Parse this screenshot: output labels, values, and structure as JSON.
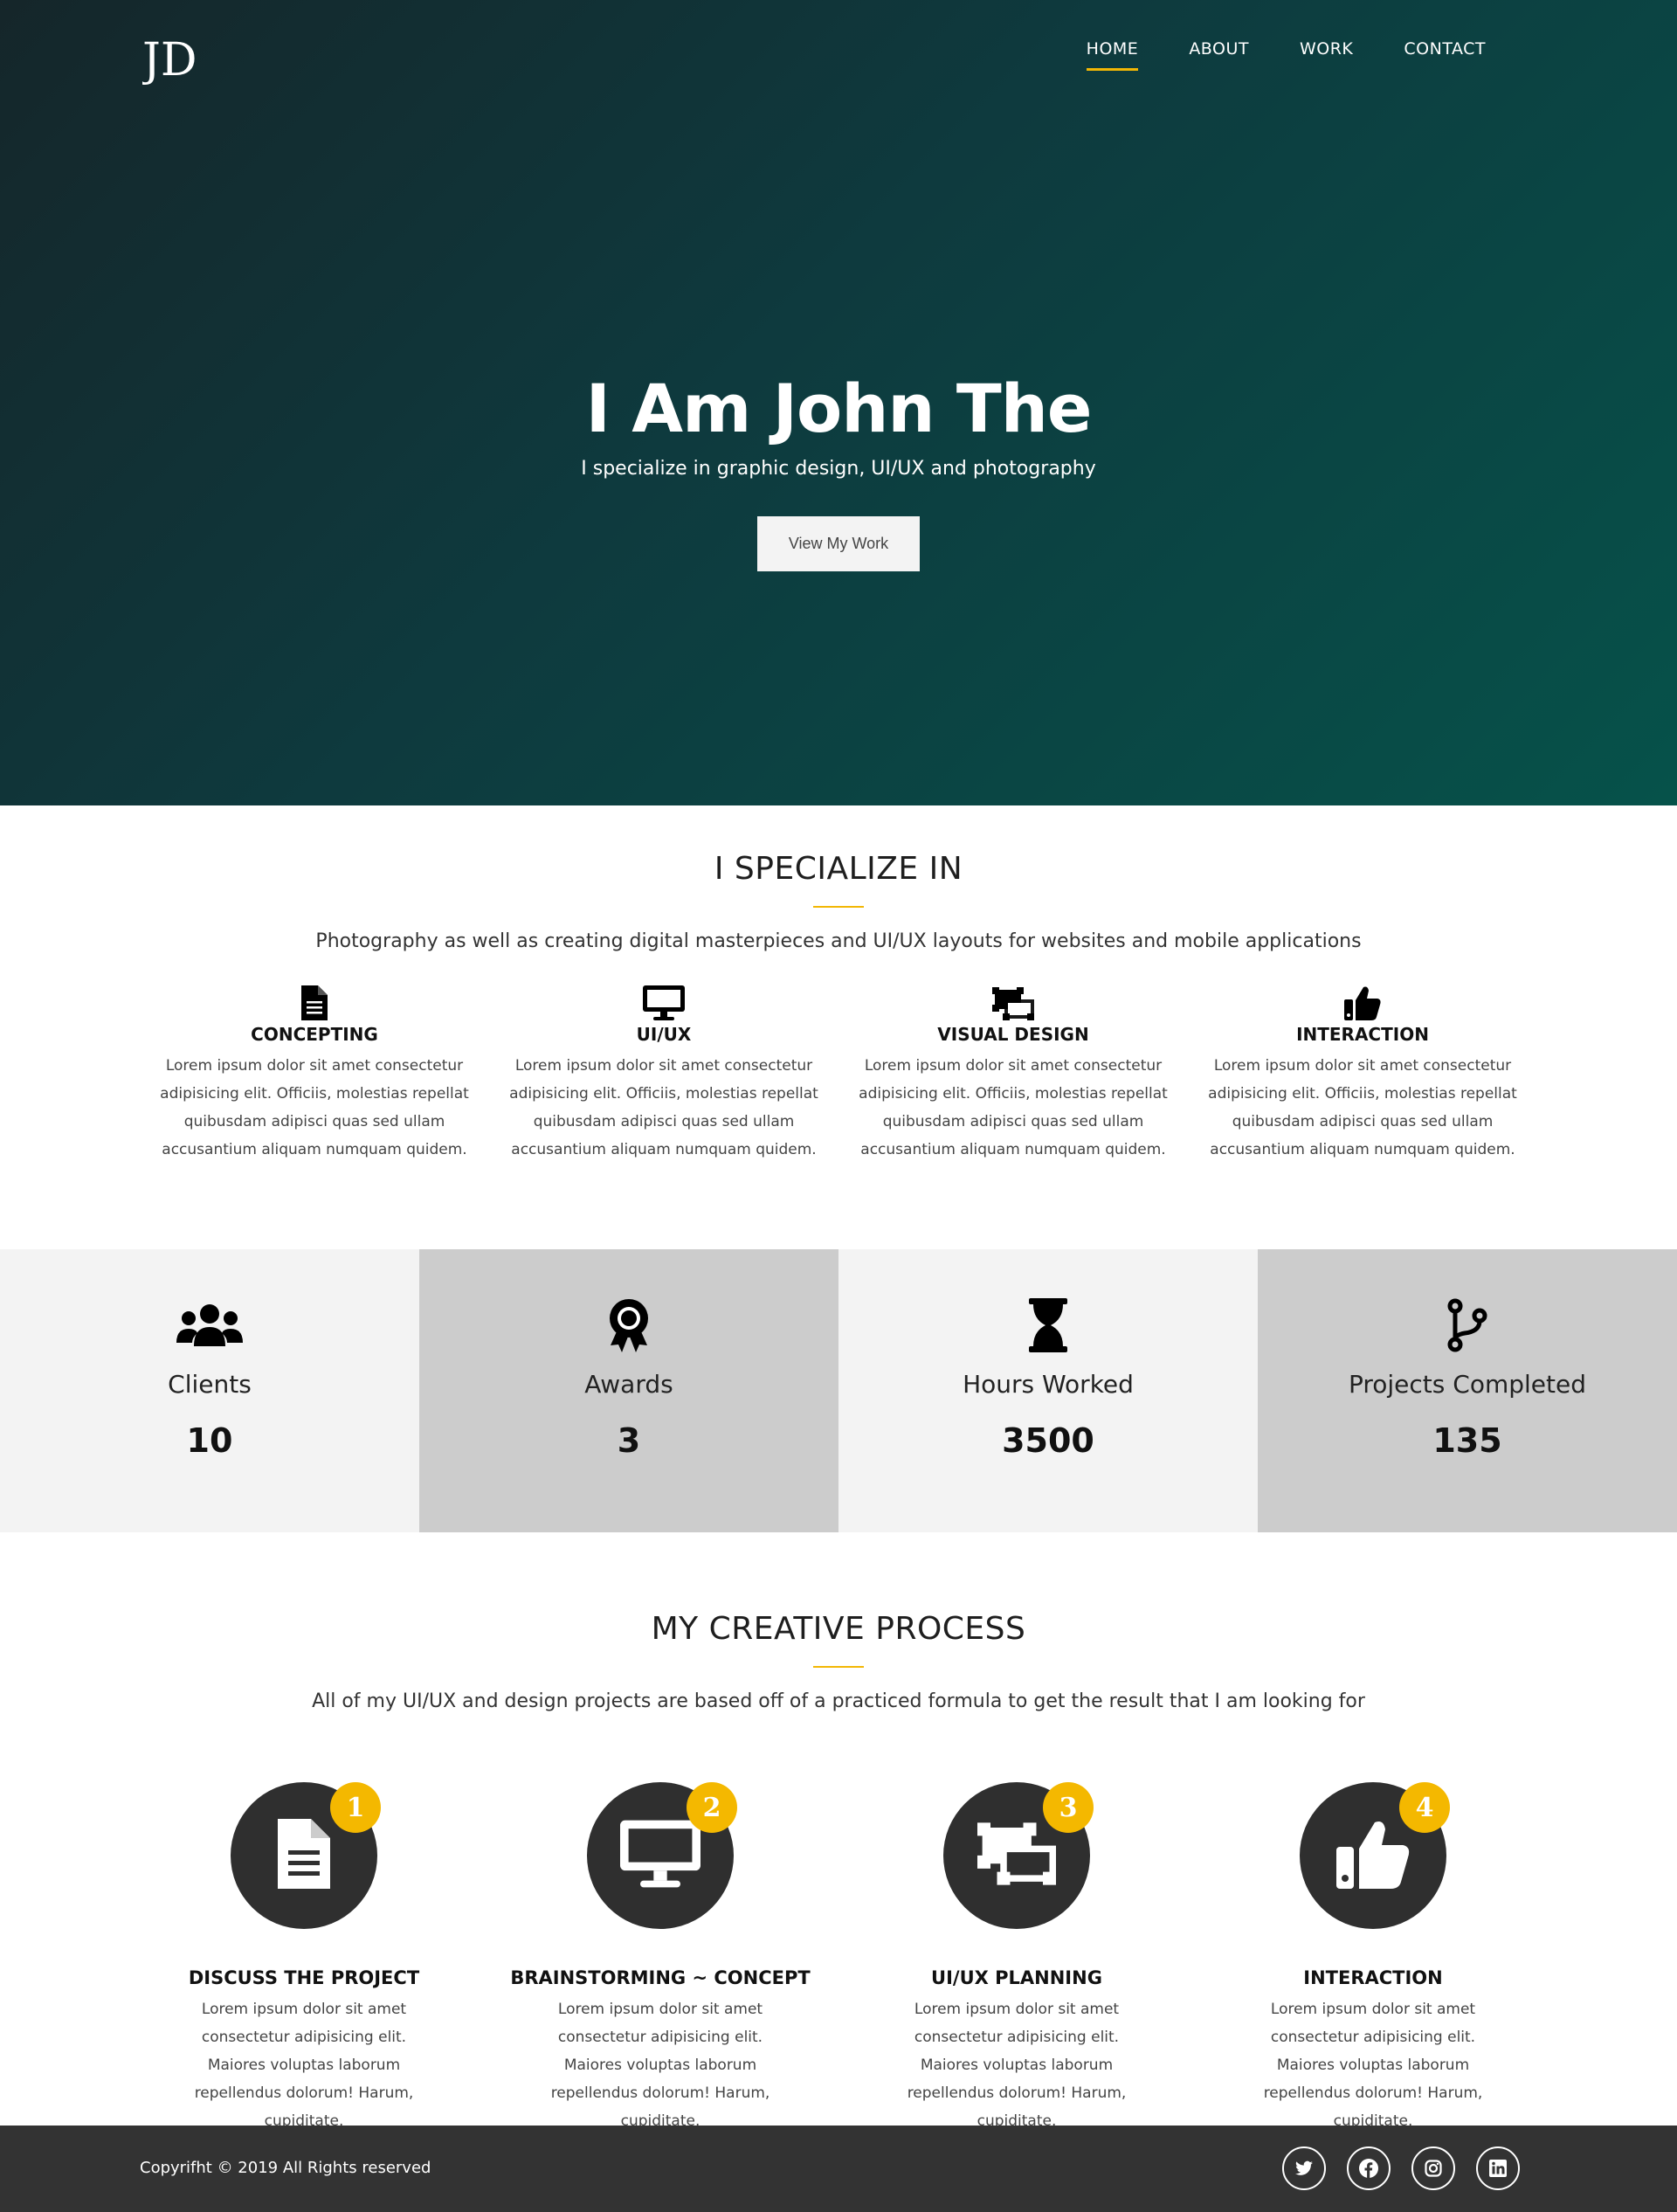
{
  "nav": {
    "logo": "JD",
    "items": [
      "HOME",
      "ABOUT",
      "WORK",
      "CONTACT"
    ],
    "active": "HOME"
  },
  "hero": {
    "title": "I Am John The",
    "subtitle": "I specialize in graphic design, UI/UX and photography",
    "button": "View My Work"
  },
  "specialize": {
    "title": "I SPECIALIZE IN",
    "description": "Photography as well as creating digital masterpieces and UI/UX layouts for websites and mobile applications",
    "items": [
      {
        "icon": "file-icon",
        "name": "CONCEPTING",
        "text": "Lorem ipsum dolor sit amet consectetur adipisicing elit. Officiis, molestias repellat quibusdam adipisci quas sed ullam accusantium aliquam numquam quidem."
      },
      {
        "icon": "monitor-icon",
        "name": "UI/UX",
        "text": "Lorem ipsum dolor sit amet consectetur adipisicing elit. Officiis, molestias repellat quibusdam adipisci quas sed ullam accusantium aliquam numquam quidem."
      },
      {
        "icon": "object-ungroup-icon",
        "name": "VISUAL DESIGN",
        "text": "Lorem ipsum dolor sit amet consectetur adipisicing elit. Officiis, molestias repellat quibusdam adipisci quas sed ullam accusantium aliquam numquam quidem."
      },
      {
        "icon": "thumbs-up-icon",
        "name": "INTERACTION",
        "text": "Lorem ipsum dolor sit amet consectetur adipisicing elit. Officiis, molestias repellat quibusdam adipisci quas sed ullam accusantium aliquam numquam quidem."
      }
    ]
  },
  "stats": [
    {
      "icon": "users-icon",
      "label": "Clients",
      "value": "10"
    },
    {
      "icon": "award-icon",
      "label": "Awards",
      "value": "3"
    },
    {
      "icon": "hourglass-icon",
      "label": "Hours Worked",
      "value": "3500"
    },
    {
      "icon": "code-branch-icon",
      "label": "Projects Completed",
      "value": "135"
    }
  ],
  "process": {
    "title": "MY CREATIVE PROCESS",
    "description": "All of my UI/UX and design projects are based off of a practiced formula to get the result that I am looking for",
    "steps": [
      {
        "number": "1",
        "icon": "file-icon",
        "name": "DISCUSS THE PROJECT",
        "text": "Lorem ipsum dolor sit amet consectetur adipisicing elit. Maiores voluptas laborum repellendus dolorum! Harum, cupiditate."
      },
      {
        "number": "2",
        "icon": "monitor-icon",
        "name": "BRAINSTORMING ~ CONCEPT",
        "text": "Lorem ipsum dolor sit amet consectetur adipisicing elit. Maiores voluptas laborum repellendus dolorum! Harum, cupiditate."
      },
      {
        "number": "3",
        "icon": "object-ungroup-icon",
        "name": "UI/UX PLANNING",
        "text": "Lorem ipsum dolor sit amet consectetur adipisicing elit. Maiores voluptas laborum repellendus dolorum! Harum, cupiditate."
      },
      {
        "number": "4",
        "icon": "thumbs-up-icon",
        "name": "INTERACTION",
        "text": "Lorem ipsum dolor sit amet consectetur adipisicing elit. Maiores voluptas laborum repellendus dolorum! Harum, cupiditate."
      }
    ]
  },
  "footer": {
    "copyright": "Copyrifht © 2019 All Rights reserved",
    "social": [
      "twitter-icon",
      "facebook-icon",
      "instagram-icon",
      "linkedin-icon"
    ]
  },
  "colors": {
    "accent": "#f2b705",
    "hero_start": "#15262a",
    "hero_end": "#06524a",
    "footer": "#333333"
  }
}
